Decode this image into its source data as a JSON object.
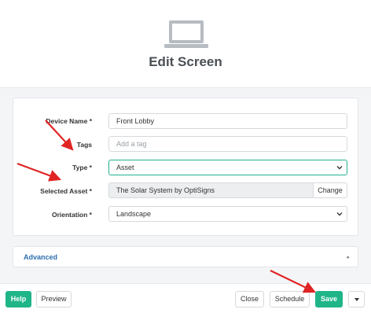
{
  "header": {
    "title": "Edit Screen",
    "icon": "laptop-icon"
  },
  "form": {
    "device_name": {
      "label": "Device Name *",
      "value": "Front Lobby"
    },
    "tags": {
      "label": "Tags",
      "placeholder": "Add a tag"
    },
    "type": {
      "label": "Type *",
      "value": "Asset"
    },
    "selected_asset": {
      "label": "Selected Asset *",
      "value": "The Solar System by OptiSigns",
      "change_label": "Change"
    },
    "orientation": {
      "label": "Orientation *",
      "value": "Landscape"
    }
  },
  "advanced": {
    "label": "Advanced"
  },
  "footer": {
    "help_label": "Help",
    "preview_label": "Preview",
    "close_label": "Close",
    "schedule_label": "Schedule",
    "save_label": "Save"
  },
  "colors": {
    "accent": "#1fb589",
    "annotation": "#e02424",
    "link": "#2f6fb0"
  }
}
